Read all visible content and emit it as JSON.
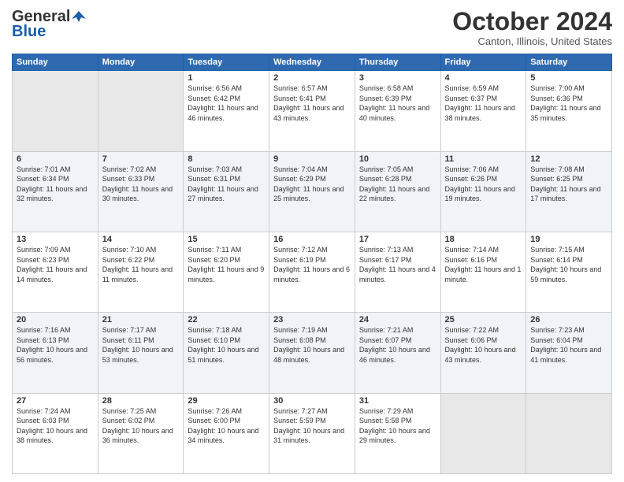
{
  "logo": {
    "general": "General",
    "blue": "Blue"
  },
  "header": {
    "month": "October 2024",
    "location": "Canton, Illinois, United States"
  },
  "weekdays": [
    "Sunday",
    "Monday",
    "Tuesday",
    "Wednesday",
    "Thursday",
    "Friday",
    "Saturday"
  ],
  "weeks": [
    [
      {
        "day": "",
        "sunrise": "",
        "sunset": "",
        "daylight": "",
        "empty": true
      },
      {
        "day": "",
        "sunrise": "",
        "sunset": "",
        "daylight": "",
        "empty": true
      },
      {
        "day": "1",
        "sunrise": "Sunrise: 6:56 AM",
        "sunset": "Sunset: 6:42 PM",
        "daylight": "Daylight: 11 hours and 46 minutes."
      },
      {
        "day": "2",
        "sunrise": "Sunrise: 6:57 AM",
        "sunset": "Sunset: 6:41 PM",
        "daylight": "Daylight: 11 hours and 43 minutes."
      },
      {
        "day": "3",
        "sunrise": "Sunrise: 6:58 AM",
        "sunset": "Sunset: 6:39 PM",
        "daylight": "Daylight: 11 hours and 40 minutes."
      },
      {
        "day": "4",
        "sunrise": "Sunrise: 6:59 AM",
        "sunset": "Sunset: 6:37 PM",
        "daylight": "Daylight: 11 hours and 38 minutes."
      },
      {
        "day": "5",
        "sunrise": "Sunrise: 7:00 AM",
        "sunset": "Sunset: 6:36 PM",
        "daylight": "Daylight: 11 hours and 35 minutes."
      }
    ],
    [
      {
        "day": "6",
        "sunrise": "Sunrise: 7:01 AM",
        "sunset": "Sunset: 6:34 PM",
        "daylight": "Daylight: 11 hours and 32 minutes."
      },
      {
        "day": "7",
        "sunrise": "Sunrise: 7:02 AM",
        "sunset": "Sunset: 6:33 PM",
        "daylight": "Daylight: 11 hours and 30 minutes."
      },
      {
        "day": "8",
        "sunrise": "Sunrise: 7:03 AM",
        "sunset": "Sunset: 6:31 PM",
        "daylight": "Daylight: 11 hours and 27 minutes."
      },
      {
        "day": "9",
        "sunrise": "Sunrise: 7:04 AM",
        "sunset": "Sunset: 6:29 PM",
        "daylight": "Daylight: 11 hours and 25 minutes."
      },
      {
        "day": "10",
        "sunrise": "Sunrise: 7:05 AM",
        "sunset": "Sunset: 6:28 PM",
        "daylight": "Daylight: 11 hours and 22 minutes."
      },
      {
        "day": "11",
        "sunrise": "Sunrise: 7:06 AM",
        "sunset": "Sunset: 6:26 PM",
        "daylight": "Daylight: 11 hours and 19 minutes."
      },
      {
        "day": "12",
        "sunrise": "Sunrise: 7:08 AM",
        "sunset": "Sunset: 6:25 PM",
        "daylight": "Daylight: 11 hours and 17 minutes."
      }
    ],
    [
      {
        "day": "13",
        "sunrise": "Sunrise: 7:09 AM",
        "sunset": "Sunset: 6:23 PM",
        "daylight": "Daylight: 11 hours and 14 minutes."
      },
      {
        "day": "14",
        "sunrise": "Sunrise: 7:10 AM",
        "sunset": "Sunset: 6:22 PM",
        "daylight": "Daylight: 11 hours and 11 minutes."
      },
      {
        "day": "15",
        "sunrise": "Sunrise: 7:11 AM",
        "sunset": "Sunset: 6:20 PM",
        "daylight": "Daylight: 11 hours and 9 minutes."
      },
      {
        "day": "16",
        "sunrise": "Sunrise: 7:12 AM",
        "sunset": "Sunset: 6:19 PM",
        "daylight": "Daylight: 11 hours and 6 minutes."
      },
      {
        "day": "17",
        "sunrise": "Sunrise: 7:13 AM",
        "sunset": "Sunset: 6:17 PM",
        "daylight": "Daylight: 11 hours and 4 minutes."
      },
      {
        "day": "18",
        "sunrise": "Sunrise: 7:14 AM",
        "sunset": "Sunset: 6:16 PM",
        "daylight": "Daylight: 11 hours and 1 minute."
      },
      {
        "day": "19",
        "sunrise": "Sunrise: 7:15 AM",
        "sunset": "Sunset: 6:14 PM",
        "daylight": "Daylight: 10 hours and 59 minutes."
      }
    ],
    [
      {
        "day": "20",
        "sunrise": "Sunrise: 7:16 AM",
        "sunset": "Sunset: 6:13 PM",
        "daylight": "Daylight: 10 hours and 56 minutes."
      },
      {
        "day": "21",
        "sunrise": "Sunrise: 7:17 AM",
        "sunset": "Sunset: 6:11 PM",
        "daylight": "Daylight: 10 hours and 53 minutes."
      },
      {
        "day": "22",
        "sunrise": "Sunrise: 7:18 AM",
        "sunset": "Sunset: 6:10 PM",
        "daylight": "Daylight: 10 hours and 51 minutes."
      },
      {
        "day": "23",
        "sunrise": "Sunrise: 7:19 AM",
        "sunset": "Sunset: 6:08 PM",
        "daylight": "Daylight: 10 hours and 48 minutes."
      },
      {
        "day": "24",
        "sunrise": "Sunrise: 7:21 AM",
        "sunset": "Sunset: 6:07 PM",
        "daylight": "Daylight: 10 hours and 46 minutes."
      },
      {
        "day": "25",
        "sunrise": "Sunrise: 7:22 AM",
        "sunset": "Sunset: 6:06 PM",
        "daylight": "Daylight: 10 hours and 43 minutes."
      },
      {
        "day": "26",
        "sunrise": "Sunrise: 7:23 AM",
        "sunset": "Sunset: 6:04 PM",
        "daylight": "Daylight: 10 hours and 41 minutes."
      }
    ],
    [
      {
        "day": "27",
        "sunrise": "Sunrise: 7:24 AM",
        "sunset": "Sunset: 6:03 PM",
        "daylight": "Daylight: 10 hours and 38 minutes."
      },
      {
        "day": "28",
        "sunrise": "Sunrise: 7:25 AM",
        "sunset": "Sunset: 6:02 PM",
        "daylight": "Daylight: 10 hours and 36 minutes."
      },
      {
        "day": "29",
        "sunrise": "Sunrise: 7:26 AM",
        "sunset": "Sunset: 6:00 PM",
        "daylight": "Daylight: 10 hours and 34 minutes."
      },
      {
        "day": "30",
        "sunrise": "Sunrise: 7:27 AM",
        "sunset": "Sunset: 5:59 PM",
        "daylight": "Daylight: 10 hours and 31 minutes."
      },
      {
        "day": "31",
        "sunrise": "Sunrise: 7:29 AM",
        "sunset": "Sunset: 5:58 PM",
        "daylight": "Daylight: 10 hours and 29 minutes."
      },
      {
        "day": "",
        "sunrise": "",
        "sunset": "",
        "daylight": "",
        "empty": true
      },
      {
        "day": "",
        "sunrise": "",
        "sunset": "",
        "daylight": "",
        "empty": true
      }
    ]
  ]
}
